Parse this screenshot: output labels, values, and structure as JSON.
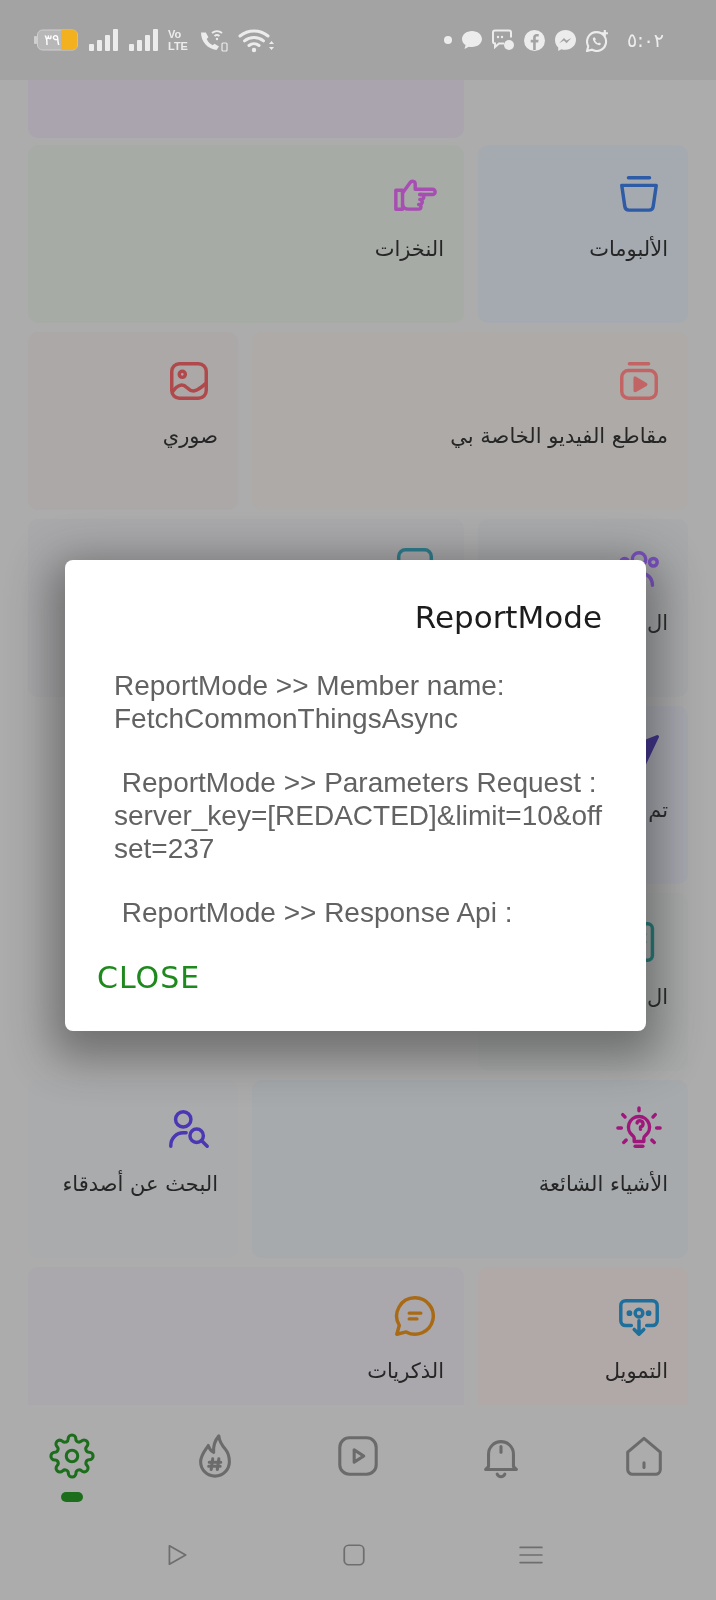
{
  "status_bar": {
    "battery": "٣٩",
    "network_top": "Vo",
    "network_bottom": "LTE",
    "time": "٥:٠٢"
  },
  "menu_rows": [
    [
      {
        "label": "الألبومات"
      },
      {
        "label": "النخزات"
      }
    ],
    [
      {
        "label": "مقاطع الفيديو الخاصة بي"
      },
      {
        "label": "صوري"
      }
    ],
    [
      {
        "label": "ال"
      }
    ],
    [
      {
        "label": "تم"
      }
    ],
    [
      {
        "label": "ال"
      }
    ],
    [
      {
        "label": "الأشياء الشائعة"
      },
      {
        "label": "البحث عن أصدقاء"
      }
    ],
    [
      {
        "label": "التمويل"
      },
      {
        "label": "الذكريات"
      }
    ]
  ],
  "dialog": {
    "title": "ReportMode",
    "paragraphs": [
      "ReportMode >> Member name: FetchCommonThingsAsync",
      " ReportMode >> Parameters Request : server_key=[REDACTED]&limit=10&offset=237",
      " ReportMode >> Response Api :"
    ],
    "button": "CLOSE"
  },
  "bottom_nav": [
    {
      "selected": false
    },
    {
      "selected": false
    },
    {
      "selected": false
    },
    {
      "selected": false
    },
    {
      "selected": true
    }
  ]
}
